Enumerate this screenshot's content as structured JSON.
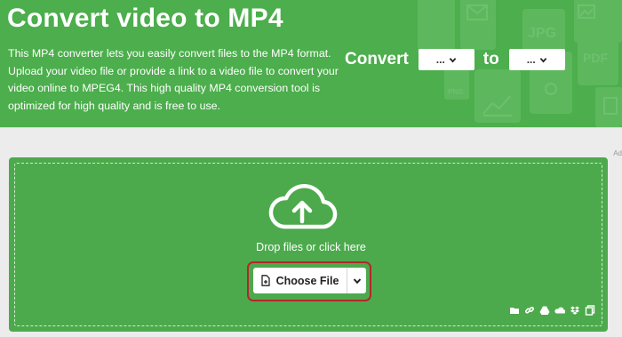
{
  "header": {
    "title": "Convert video to MP4",
    "description": "This MP4 converter lets you easily convert files to the MP4 format. Upload your video file or provide a link to a video file to convert your video online to MPEG4. This high quality MP4 conversion tool is optimized for high quality and is free to use.",
    "convert_label": "Convert",
    "to_label": "to",
    "from_format": "...",
    "to_format": "...",
    "background_file_labels": [
      "JPG",
      "PDF",
      "PNG"
    ]
  },
  "ad_marker": "Ad",
  "upload": {
    "drop_text": "Drop files or click here",
    "choose_file_label": "Choose File",
    "source_icons": [
      "folder-icon",
      "link-icon",
      "google-drive-icon",
      "onedrive-icon",
      "dropbox-icon",
      "clipboard-icon"
    ]
  },
  "colors": {
    "header_green": "#4cae4c",
    "upload_green": "#4caa4c",
    "highlight_red": "#b3262c",
    "page_background": "#ececec"
  }
}
